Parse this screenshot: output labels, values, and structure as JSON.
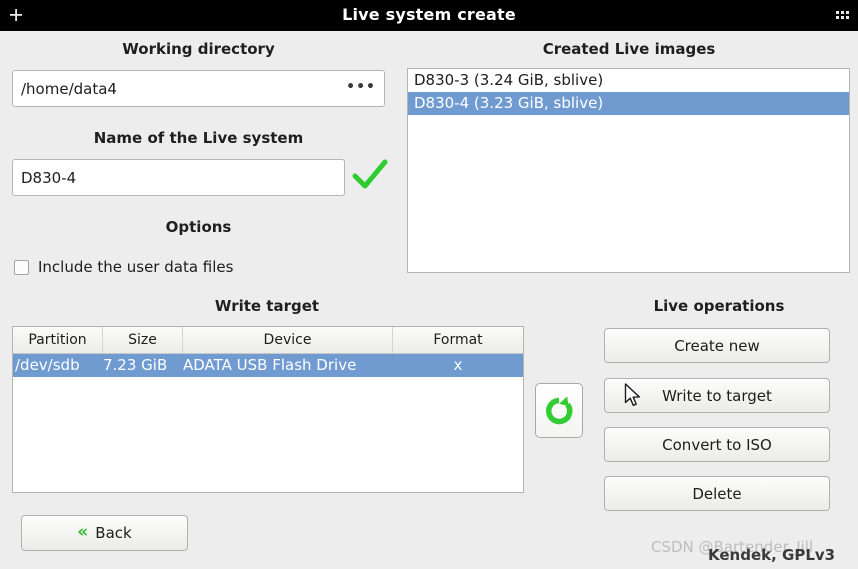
{
  "window": {
    "title": "Live system create",
    "left_icon": "window-menu-icon",
    "right_icon": "grid-dots-icon"
  },
  "working_directory": {
    "label": "Working directory",
    "value": "/home/data4",
    "browse_label": "•••"
  },
  "live_system_name": {
    "label": "Name of the Live system",
    "value": "D830-4",
    "valid_icon": "green-check-icon"
  },
  "options": {
    "label": "Options",
    "include_user_data": {
      "label": "Include the user data files",
      "checked": false
    }
  },
  "created_live_images": {
    "label": "Created Live images",
    "items": [
      {
        "text": "D830-3 (3.24 GiB, sblive)",
        "selected": false
      },
      {
        "text": "D830-4 (3.23 GiB, sblive)",
        "selected": true
      }
    ]
  },
  "write_target": {
    "label": "Write target",
    "columns": [
      "Partition",
      "Size",
      "Device",
      "Format"
    ],
    "rows": [
      {
        "partition": "/dev/sdb",
        "size": "7.23 GiB",
        "device": "ADATA USB Flash Drive",
        "format": "x",
        "selected": true
      }
    ],
    "refresh_icon": "refresh-circular-arrow-icon"
  },
  "live_operations": {
    "label": "Live operations",
    "buttons": [
      {
        "label": "Create new",
        "name": "create-new-button"
      },
      {
        "label": "Write to target",
        "name": "write-to-target-button"
      },
      {
        "label": "Convert to ISO",
        "name": "convert-to-iso-button"
      },
      {
        "label": "Delete",
        "name": "delete-button"
      }
    ]
  },
  "back_button": {
    "label": "Back",
    "icon": "double-chevron-left-icon"
  },
  "watermark": "CSDN @Bartender_Jill",
  "footer_credit": "Kendek, GPLv3",
  "colors": {
    "selection_blue": "#6f9bd1",
    "accent_green": "#2fbb2f",
    "window_background": "#ededed",
    "titlebar_background": "#000000"
  }
}
